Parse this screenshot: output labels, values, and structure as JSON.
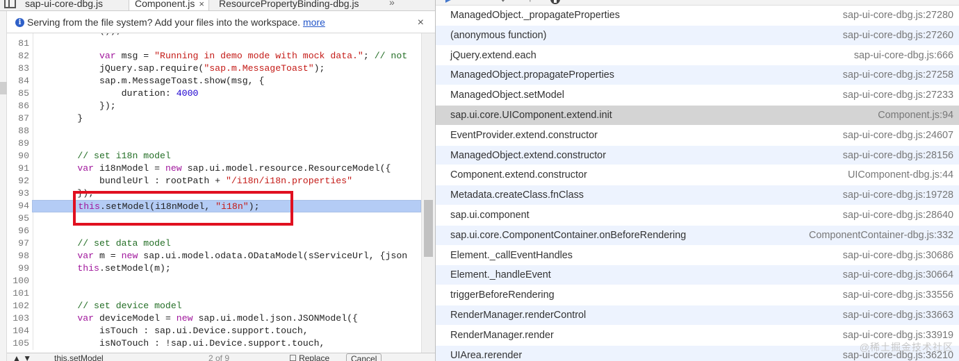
{
  "tabs": [
    {
      "label": "sap-ui-core-dbg.js",
      "close": ""
    },
    {
      "label": "Component.js",
      "close": "×"
    },
    {
      "label": "ResourcePropertyBinding-dbg.js",
      "close": ""
    }
  ],
  "tab_overflow": "»",
  "infobar": {
    "icon": "i",
    "text": "Serving from the file system? Add your files into the workspace.",
    "link": "more",
    "close": "×"
  },
  "highlight_line": "94",
  "code_lines": [
    {
      "n": "",
      "t": "            ());"
    },
    {
      "n": "81",
      "t": ""
    },
    {
      "n": "82",
      "t": "            var msg = \"Running in demo mode with mock data.\"; // not"
    },
    {
      "n": "83",
      "t": "            jQuery.sap.require(\"sap.m.MessageToast\");"
    },
    {
      "n": "84",
      "t": "            sap.m.MessageToast.show(msg, {"
    },
    {
      "n": "85",
      "t": "                duration: 4000"
    },
    {
      "n": "86",
      "t": "            });"
    },
    {
      "n": "87",
      "t": "        }"
    },
    {
      "n": "88",
      "t": ""
    },
    {
      "n": "89",
      "t": ""
    },
    {
      "n": "90",
      "t": "        // set i18n model"
    },
    {
      "n": "91",
      "t": "        var i18nModel = new sap.ui.model.resource.ResourceModel({"
    },
    {
      "n": "92",
      "t": "            bundleUrl : rootPath + \"/i18n/i18n.properties\""
    },
    {
      "n": "93",
      "t": "        });"
    },
    {
      "n": "94",
      "t": "        this.setModel(i18nModel, \"i18n\");"
    },
    {
      "n": "95",
      "t": ""
    },
    {
      "n": "96",
      "t": ""
    },
    {
      "n": "97",
      "t": "        // set data model"
    },
    {
      "n": "98",
      "t": "        var m = new sap.ui.model.odata.ODataModel(sServiceUrl, {json"
    },
    {
      "n": "99",
      "t": "        this.setModel(m);"
    },
    {
      "n": "100",
      "t": ""
    },
    {
      "n": "101",
      "t": ""
    },
    {
      "n": "102",
      "t": "        // set device model"
    },
    {
      "n": "103",
      "t": "        var deviceModel = new sap.ui.model.json.JSONModel({"
    },
    {
      "n": "104",
      "t": "            isTouch : sap.ui.Device.support.touch,"
    },
    {
      "n": "105",
      "t": "            isNoTouch : !sap.ui.Device.support.touch,"
    }
  ],
  "findbar": {
    "value": "this.setModel",
    "count": "2 of 9",
    "replace_label": "Replace",
    "cancel_label": "Cancel"
  },
  "call_stack": [
    {
      "fn": "ManagedObject._propagateProperties",
      "loc": "sap-ui-core-dbg.js:27280"
    },
    {
      "fn": "(anonymous function)",
      "loc": "sap-ui-core-dbg.js:27260"
    },
    {
      "fn": "jQuery.extend.each",
      "loc": "sap-ui-core-dbg.js:666"
    },
    {
      "fn": "ManagedObject.propagateProperties",
      "loc": "sap-ui-core-dbg.js:27258"
    },
    {
      "fn": "ManagedObject.setModel",
      "loc": "sap-ui-core-dbg.js:27233"
    },
    {
      "fn": "sap.ui.core.UIComponent.extend.init",
      "loc": "Component.js:94",
      "selected": true
    },
    {
      "fn": "EventProvider.extend.constructor",
      "loc": "sap-ui-core-dbg.js:24607"
    },
    {
      "fn": "ManagedObject.extend.constructor",
      "loc": "sap-ui-core-dbg.js:28156"
    },
    {
      "fn": "Component.extend.constructor",
      "loc": "UIComponent-dbg.js:44"
    },
    {
      "fn": "Metadata.createClass.fnClass",
      "loc": "sap-ui-core-dbg.js:19728"
    },
    {
      "fn": "sap.ui.component",
      "loc": "sap-ui-core-dbg.js:28640"
    },
    {
      "fn": "sap.ui.core.ComponentContainer.onBeforeRendering",
      "loc": "ComponentContainer-dbg.js:332"
    },
    {
      "fn": "Element._callEventHandles",
      "loc": "sap-ui-core-dbg.js:30686"
    },
    {
      "fn": "Element._handleEvent",
      "loc": "sap-ui-core-dbg.js:30664"
    },
    {
      "fn": "triggerBeforeRendering",
      "loc": "sap-ui-core-dbg.js:33556"
    },
    {
      "fn": "RenderManager.renderControl",
      "loc": "sap-ui-core-dbg.js:33663"
    },
    {
      "fn": "RenderManager.render",
      "loc": "sap-ui-core-dbg.js:33919"
    },
    {
      "fn": "UIArea.rerender",
      "loc": "sap-ui-core-dbg.js:36210"
    }
  ],
  "watermark": "@稀土掘金技术社区",
  "colors": {
    "highlight": "#b4ccf5",
    "selected_frame": "#d4d4d4",
    "odd_frame": "#edf3fe",
    "red_box": "#e01020"
  }
}
